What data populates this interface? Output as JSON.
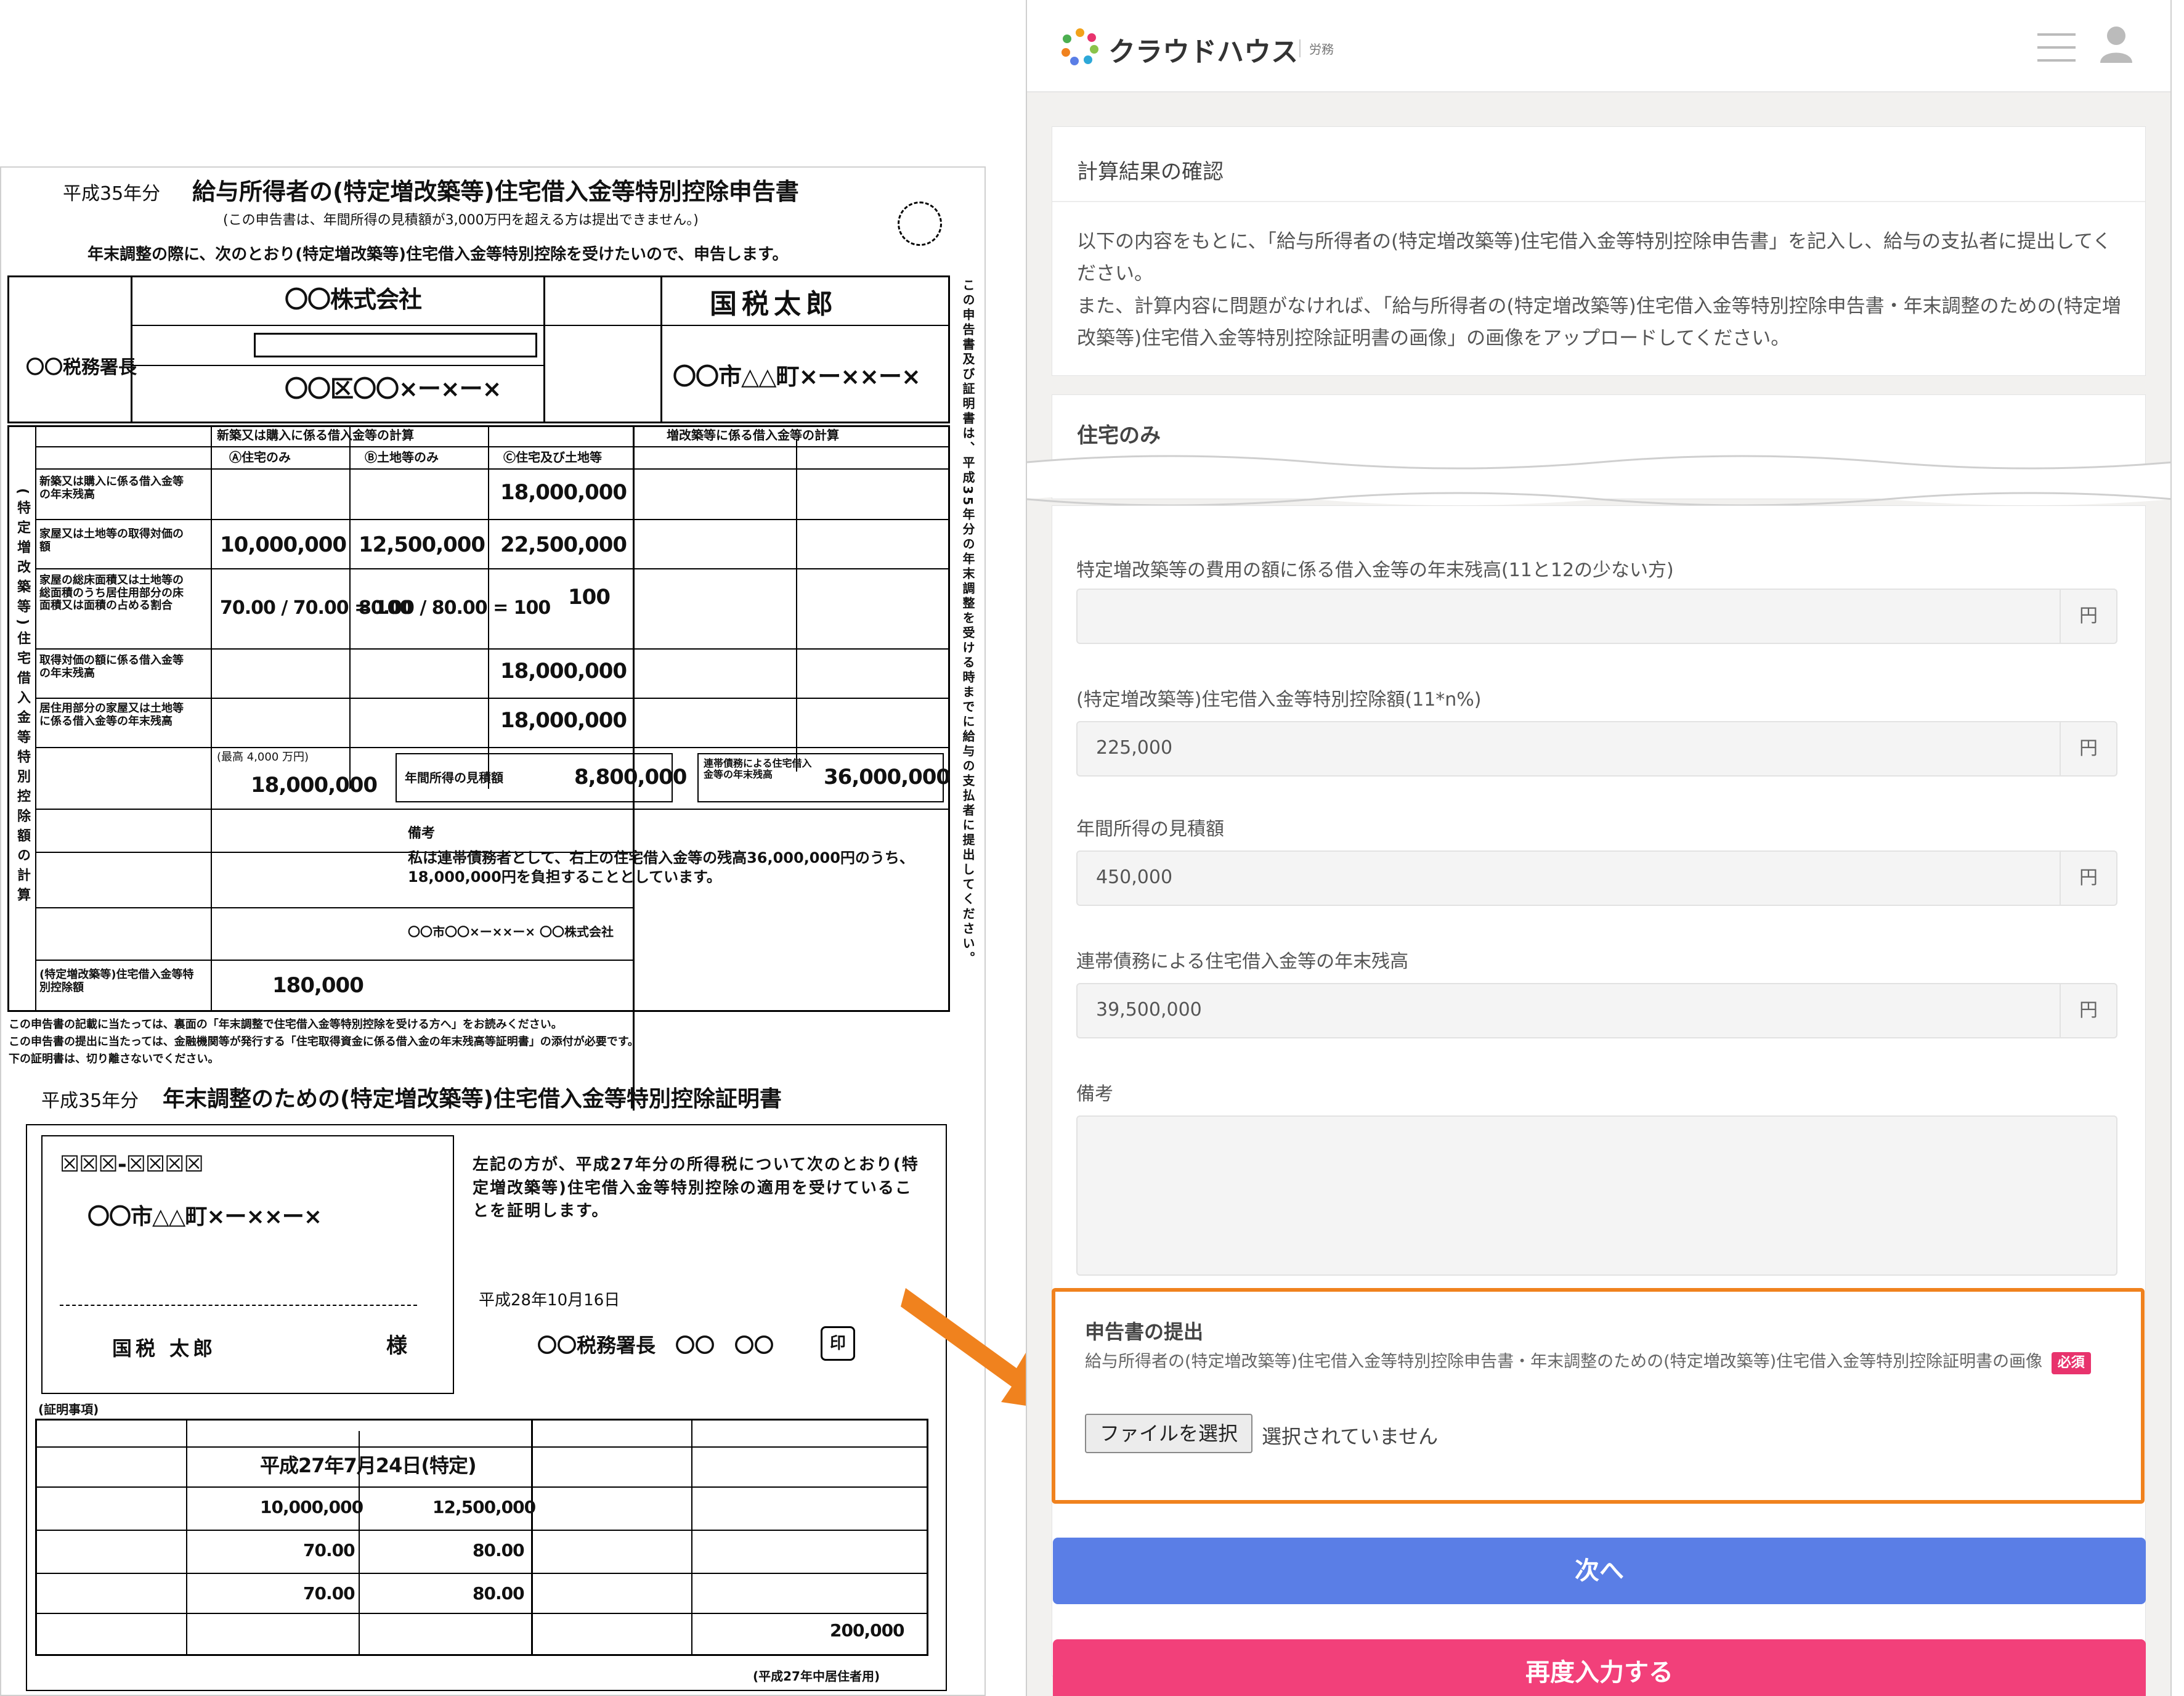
{
  "form": {
    "era_year": "平成35年分",
    "title": "給与所得者の(特定増改築等)住宅借入金等特別控除申告書",
    "subtitle": "(この申告書は、年間所得の見積額が3,000万円を超える方は提出できません。)",
    "intro": "年末調整の際に、次のとおり(特定増改築等)住宅借入金等特別控除を受けたいので、申告します。",
    "tax_office": "〇〇税務署長",
    "payer_name": "〇〇株式会社",
    "payer_address": "〇〇区〇〇×ー×ー×",
    "applicant_name": "国税太郎",
    "applicant_address": "〇〇市△△町×ー××ー×",
    "section_left": "新築又は購入に係る借入金等の計算",
    "section_right": "増改築等に係る借入金等の計算",
    "col_a": "Ⓐ住宅のみ",
    "col_b": "Ⓑ土地等のみ",
    "col_c": "Ⓒ住宅及び土地等",
    "rows": [
      {
        "label": "新築又は購入に係る借入金等の年末残高",
        "a": "",
        "b": "",
        "c": "18,000,000"
      },
      {
        "label": "家屋又は土地等の取得対価の額",
        "a": "10,000,000",
        "b": "12,500,000",
        "c": "22,500,000"
      },
      {
        "label": "家屋の総床面積又は土地等の総面積のうち居住用部分の床面積又は面積の占める割合",
        "a": "70.00 / 70.00 = 100",
        "b": "80.00 / 80.00 = 100",
        "c": "100"
      },
      {
        "label": "取得対価の額に係る借入金等の年末残高",
        "a": "",
        "b": "",
        "c": "18,000,000"
      },
      {
        "label": "居住用部分の家屋又は土地等に係る借入金等の年末残高",
        "a": "",
        "b": "",
        "c": "18,000,000"
      }
    ],
    "total_loan": "18,000,000",
    "total_loan_cap": "(最高 4,000 万円)",
    "annual_income_label": "年間所得の見積額",
    "annual_income": "8,800,000",
    "joint_debt_label": "連帯債務による住宅借入金等の年末残高",
    "joint_debt": "36,000,000",
    "deduction_label": "(特定増改築等)住宅借入金等特別控除額",
    "deduction": "180,000",
    "remarks_title": "備考",
    "remarks_text": "私は連帯債務者として、右上の住宅借入金等の残高36,000,000円のうち、18,000,000円を負担することとしています。",
    "remarks_company": "〇〇市〇〇×ー××ー× 〇〇株式会社",
    "notes": [
      "この申告書の記載に当たっては、裏面の「年末調整で住宅借入金等特別控除を受ける方へ」をお読みください。",
      "この申告書の提出に当たっては、金融機関等が発行する「住宅取得資金に係る借入金の年末残高等証明書」の添付が必要です。",
      "下の証明書は、切り離さないでください。"
    ],
    "cert_year": "平成35年分",
    "cert_title": "年末調整のための(特定増改築等)住宅借入金等特別控除証明書",
    "cert_postal": "☒☒☒-☒☒☒☒",
    "cert_address": "〇〇市△△町×ー××ー×",
    "cert_name": "国税 太郎",
    "cert_honorific": "様",
    "cert_text": "左記の方が、平成27年分の所得税について次のとおり(特定増改築等)住宅借入金等特別控除の適用を受けていることを証明します。",
    "cert_date": "平成28年10月16日",
    "cert_office": "〇〇税務署長　〇〇　〇〇",
    "cert_seal": "印",
    "cert_items_title": "(証明事項)",
    "cert_move_in": "平成27年7月24日(特定)",
    "cert_house_price": "10,000,000",
    "cert_land_price": "12,500,000",
    "cert_house_area": "70.00",
    "cert_land_area": "80.00",
    "cert_house_res": "70.00",
    "cert_land_res": "80.00",
    "cert_reno_amount": "200,000",
    "cert_footer": "(平成27年中居住者用)"
  },
  "app": {
    "brand": "クラウドハウス",
    "brand_sub": "労務",
    "section1_title": "計算結果の確認",
    "section1_body_1": "以下の内容をもとに、「給与所得者の(特定増改築等)住宅借入金等特別控除申告書」を記入し、給与の支払者に提出してください。",
    "section1_body_2": "また、計算内容に問題がなければ、「給与所得者の(特定増改築等)住宅借入金等特別控除申告書・年末調整のための(特定増改築等)住宅借入金等特別控除証明書の画像」の画像をアップロードしてください。",
    "section2_title": "住宅のみ",
    "fields": [
      {
        "label": "特定増改築等の費用の額に係る借入金等の年末残高(11と12の少ない方)",
        "value": "",
        "unit": "円"
      },
      {
        "label": "(特定増改築等)住宅借入金等特別控除額(11*n%)",
        "value": "225,000",
        "unit": "円"
      },
      {
        "label": "年間所得の見積額",
        "value": "450,000",
        "unit": "円"
      },
      {
        "label": "連帯債務による住宅借入金等の年末残高",
        "value": "39,500,000",
        "unit": "円"
      }
    ],
    "remarks_label": "備考",
    "upload_title": "申告書の提出",
    "upload_desc": "給与所得者の(特定増改築等)住宅借入金等特別控除申告書・年末調整のための(特定増改築等)住宅借入金等特別控除証明書の画像",
    "required_badge": "必須",
    "file_button": "ファイルを選択",
    "file_status": "選択されていません",
    "next_button": "次へ",
    "reenter_button": "再度入力する",
    "colors": {
      "highlight": "#f0821e",
      "next": "#5a7ee6",
      "reenter": "#f2407a",
      "required": "#e8336d"
    }
  }
}
